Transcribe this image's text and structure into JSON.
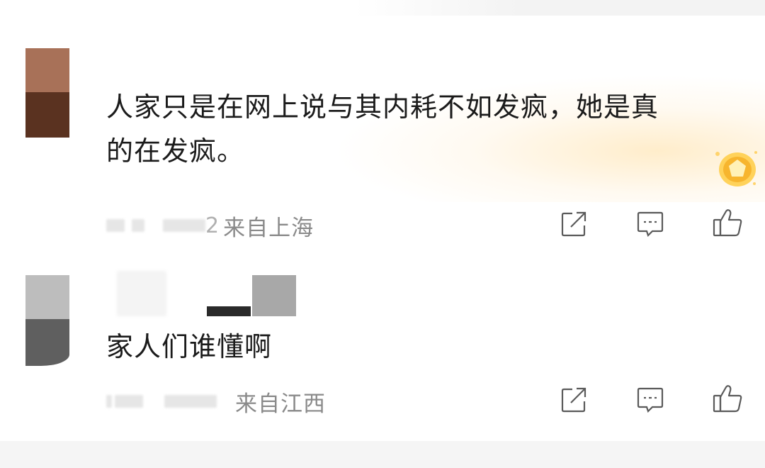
{
  "comments": [
    {
      "text_line1": "人家只是在网上说与其内耗不如发疯，她是真",
      "text_line2": "的在发疯。",
      "meta_suffix": "2",
      "location": "来自上海"
    },
    {
      "text_line1": "家人们谁懂啊",
      "location": "来自江西"
    }
  ],
  "icons": {
    "share": "share-icon",
    "comment": "comment-icon",
    "like": "thumbs-up-icon",
    "badge": "gold-badge-icon"
  },
  "colors": {
    "text": "#1b1b1b",
    "meta": "#8a8a8a",
    "icon": "#5a5a5a",
    "badge": "#f5b733"
  }
}
